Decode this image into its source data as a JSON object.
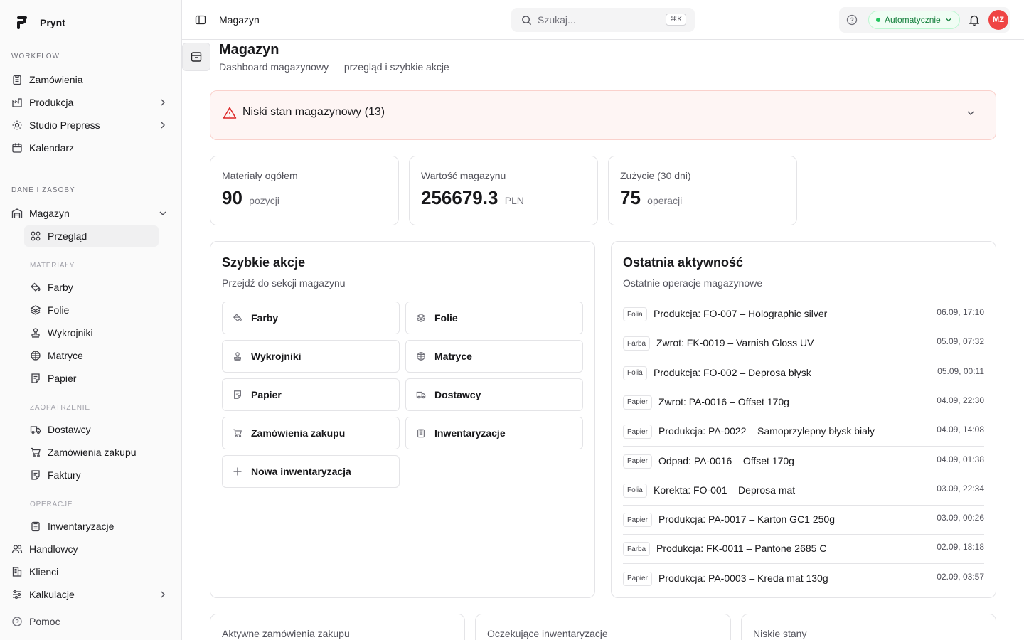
{
  "app": {
    "name": "Prynt"
  },
  "sidebar": {
    "groups": {
      "workflow": "WORKFLOW",
      "dane": "DANE I ZASOBY"
    },
    "items": {
      "zamowienia": "Zamówienia",
      "produkcja": "Produkcja",
      "studio": "Studio Prepress",
      "kalendarz": "Kalendarz",
      "magazyn": "Magazyn",
      "przeglad": "Przegląd",
      "farby": "Farby",
      "folie": "Folie",
      "wykrojniki": "Wykrojniki",
      "matryce": "Matryce",
      "papier": "Papier",
      "dostawcy": "Dostawcy",
      "zamowienia_zakupu": "Zamówienia zakupu",
      "faktury": "Faktury",
      "inwentaryzacje": "Inwentaryzacje",
      "handlowcy": "Handlowcy",
      "klienci": "Klienci",
      "kalkulacje": "Kalkulacje"
    },
    "subgroups": {
      "materialy": "MATERIAŁY",
      "zaopatrzenie": "ZAOPATRZENIE",
      "operacje": "OPERACJE"
    },
    "help": "Pomoc"
  },
  "topbar": {
    "breadcrumb": "Magazyn",
    "search_placeholder": "Szukaj...",
    "shortcut": "⌘K",
    "mode": "Automatycznie",
    "avatar": "MZ"
  },
  "page": {
    "title": "Magazyn",
    "subtitle": "Dashboard magazynowy — przegląd i szybkie akcje"
  },
  "alert": {
    "text": "Niski stan magazynowy (13)"
  },
  "stats": [
    {
      "label": "Materiały ogółem",
      "value": "90",
      "unit": "pozycji"
    },
    {
      "label": "Wartość magazynu",
      "value": "256679.3",
      "unit": "PLN"
    },
    {
      "label": "Zużycie (30 dni)",
      "value": "75",
      "unit": "operacji"
    }
  ],
  "quick_actions": {
    "title": "Szybkie akcje",
    "subtitle": "Przejdź do sekcji magazynu",
    "items": {
      "farby": "Farby",
      "folie": "Folie",
      "wykrojniki": "Wykrojniki",
      "matryce": "Matryce",
      "papier": "Papier",
      "dostawcy": "Dostawcy",
      "zamowienia_zakupu": "Zamówienia zakupu",
      "inwentaryzacje": "Inwentaryzacje",
      "nowa_inwentaryzacja": "Nowa inwentaryzacja"
    }
  },
  "activity": {
    "title": "Ostatnia aktywność",
    "subtitle": "Ostatnie operacje magazynowe",
    "rows": [
      {
        "tag": "Folia",
        "desc": "Produkcja: FO-007 – Holographic silver",
        "time": "06.09, 17:10"
      },
      {
        "tag": "Farba",
        "desc": "Zwrot: FK-0019 – Varnish Gloss UV",
        "time": "05.09, 07:32"
      },
      {
        "tag": "Folia",
        "desc": "Produkcja: FO-002 – Deprosa błysk",
        "time": "05.09, 00:11"
      },
      {
        "tag": "Papier",
        "desc": "Zwrot: PA-0016 – Offset 170g",
        "time": "04.09, 22:30"
      },
      {
        "tag": "Papier",
        "desc": "Produkcja: PA-0022 – Samoprzylepny błysk biały",
        "time": "04.09, 14:08"
      },
      {
        "tag": "Papier",
        "desc": "Odpad: PA-0016 – Offset 170g",
        "time": "04.09, 01:38"
      },
      {
        "tag": "Folia",
        "desc": "Korekta: FO-001 – Deprosa mat",
        "time": "03.09, 22:34"
      },
      {
        "tag": "Papier",
        "desc": "Produkcja: PA-0017 – Karton GC1 250g",
        "time": "03.09, 00:26"
      },
      {
        "tag": "Farba",
        "desc": "Produkcja: FK-0011 – Pantone 2685 C",
        "time": "02.09, 18:18"
      },
      {
        "tag": "Papier",
        "desc": "Produkcja: PA-0003 – Kreda mat 130g",
        "time": "02.09, 03:57"
      }
    ]
  },
  "bottom_cards": [
    {
      "label": "Aktywne zamówienia zakupu"
    },
    {
      "label": "Oczekujące inwentaryzacje"
    },
    {
      "label": "Niskie stany"
    }
  ]
}
